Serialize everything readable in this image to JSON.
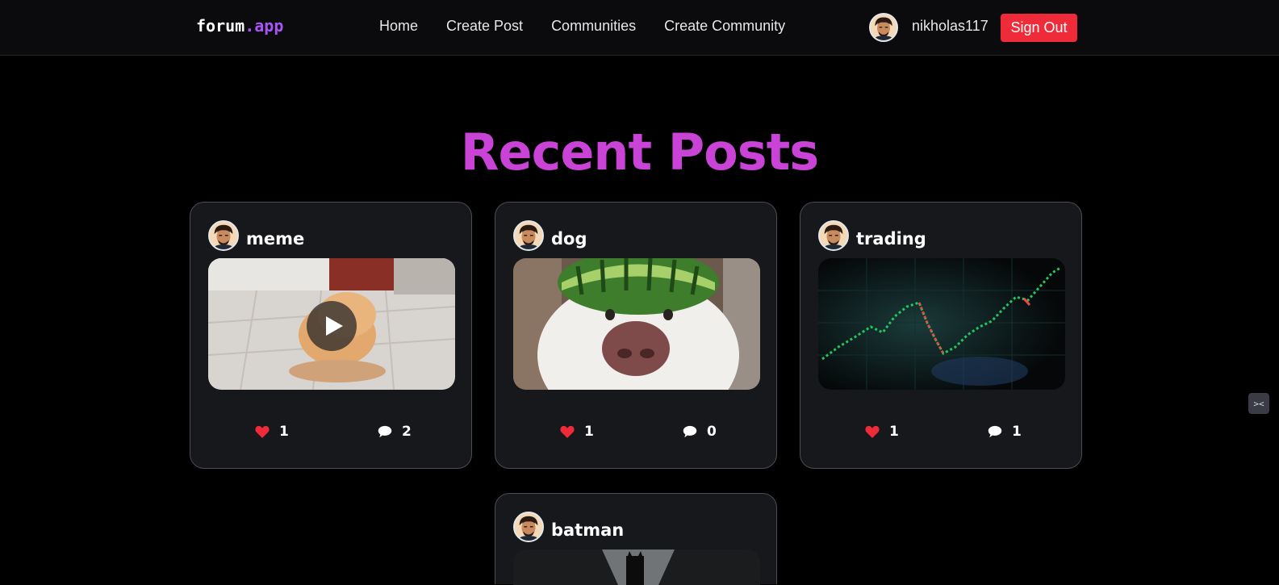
{
  "nav": {
    "logo_main": "forum",
    "logo_accent": ".app",
    "links": [
      "Home",
      "Create Post",
      "Communities",
      "Create Community"
    ],
    "username": "nikholas117",
    "signout_label": "Sign Out"
  },
  "main": {
    "title": "Recent Posts",
    "posts": [
      {
        "title": "meme",
        "likes": "1",
        "comments": "2",
        "media": "video"
      },
      {
        "title": "dog",
        "likes": "1",
        "comments": "0",
        "media": "image"
      },
      {
        "title": "trading",
        "likes": "1",
        "comments": "1",
        "media": "image"
      },
      {
        "title": "batman",
        "media": "image"
      }
    ]
  },
  "colors": {
    "accent": "#a855f7",
    "title": "#c944d6",
    "signout": "#ef2b3a",
    "like": "#ef2b3a"
  },
  "icons": {
    "like": "heart-icon",
    "comment": "comment-icon",
    "play": "play-icon"
  }
}
